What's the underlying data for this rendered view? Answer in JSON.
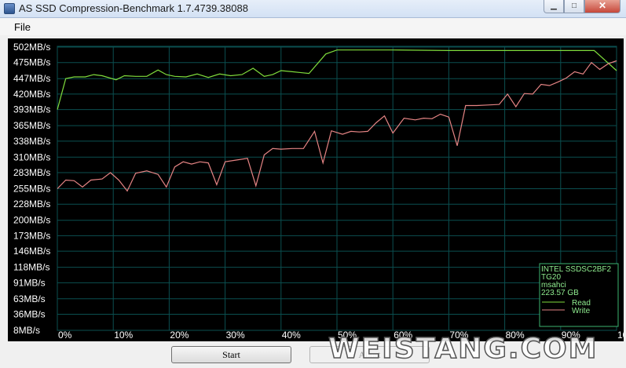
{
  "window": {
    "title": "AS SSD Compression-Benchmark 1.7.4739.38088",
    "minimize_glyph": "▁",
    "maximize_glyph": "□",
    "close_glyph": "✕"
  },
  "menu": {
    "file": "File"
  },
  "buttons": {
    "start": "Start",
    "abort": "Abort"
  },
  "watermark": "WEISTANG.COM",
  "colors": {
    "read": "#7fdc3c",
    "write": "#e58484",
    "grid": "#0b4f50",
    "legend_border": "#3cb371"
  },
  "chart_data": {
    "type": "line",
    "y_tick_labels": [
      "502MB/s",
      "475MB/s",
      "447MB/s",
      "420MB/s",
      "393MB/s",
      "365MB/s",
      "338MB/s",
      "310MB/s",
      "283MB/s",
      "255MB/s",
      "228MB/s",
      "200MB/s",
      "173MB/s",
      "146MB/s",
      "118MB/s",
      "91MB/s",
      "63MB/s",
      "36MB/s",
      "8MB/s"
    ],
    "y_ticks": [
      502,
      475,
      447,
      420,
      393,
      365,
      338,
      310,
      283,
      255,
      228,
      200,
      173,
      146,
      118,
      91,
      63,
      36,
      8
    ],
    "x_tick_labels": [
      "0%",
      "10%",
      "20%",
      "30%",
      "40%",
      "50%",
      "60%",
      "70%",
      "80%",
      "90%",
      "100%"
    ],
    "xlim": [
      0,
      100
    ],
    "ylim": [
      8,
      502
    ],
    "grid": true,
    "legend": {
      "position": "bottom-right",
      "info": [
        "INTEL SSDSC2BF2",
        "TG20",
        "msahci",
        "223.57 GB"
      ],
      "entries": [
        "Read",
        "Write"
      ]
    },
    "series": [
      {
        "name": "Read",
        "x": [
          0,
          1.5,
          3,
          5,
          6.5,
          8,
          10.5,
          12,
          14,
          16,
          18,
          19.5,
          21,
          23,
          25,
          27,
          29,
          31,
          33,
          35,
          37,
          38.5,
          40,
          42,
          45,
          48,
          50,
          55,
          60,
          70,
          80,
          90,
          93,
          96,
          100
        ],
        "y": [
          393,
          447,
          450,
          450,
          454,
          452,
          445,
          452,
          451,
          451,
          462,
          454,
          451,
          450,
          455,
          449,
          455,
          452,
          454,
          465,
          451,
          454,
          461,
          459,
          456,
          490,
          497,
          497,
          497,
          496,
          496,
          496,
          496,
          496,
          461
        ]
      },
      {
        "name": "Write",
        "x": [
          0,
          1.5,
          3,
          4.5,
          6,
          8,
          9.5,
          11,
          12.5,
          14,
          16,
          18,
          19.5,
          21,
          22.5,
          24,
          25.5,
          27,
          28.5,
          30,
          32,
          34,
          35.5,
          37,
          38.5,
          40,
          42,
          44,
          46,
          47.5,
          49,
          51,
          52.5,
          54,
          55.5,
          57,
          58.5,
          60,
          62,
          64,
          65.5,
          67,
          68.5,
          70,
          71.5,
          73,
          75,
          77,
          79,
          80.5,
          82,
          83.5,
          85,
          86.5,
          88,
          89.5,
          91,
          92.5,
          94,
          95.5,
          97,
          98.5,
          100
        ],
        "y": [
          255,
          270,
          269,
          258,
          270,
          272,
          283,
          270,
          251,
          282,
          286,
          280,
          258,
          293,
          302,
          298,
          302,
          300,
          262,
          302,
          305,
          308,
          260,
          314,
          325,
          324,
          325,
          325,
          355,
          300,
          356,
          350,
          355,
          354,
          355,
          370,
          382,
          352,
          378,
          375,
          378,
          377,
          385,
          380,
          330,
          400,
          400,
          401,
          402,
          420,
          398,
          421,
          420,
          437,
          435,
          441,
          448,
          459,
          455,
          475,
          463,
          473,
          478
        ]
      }
    ]
  }
}
